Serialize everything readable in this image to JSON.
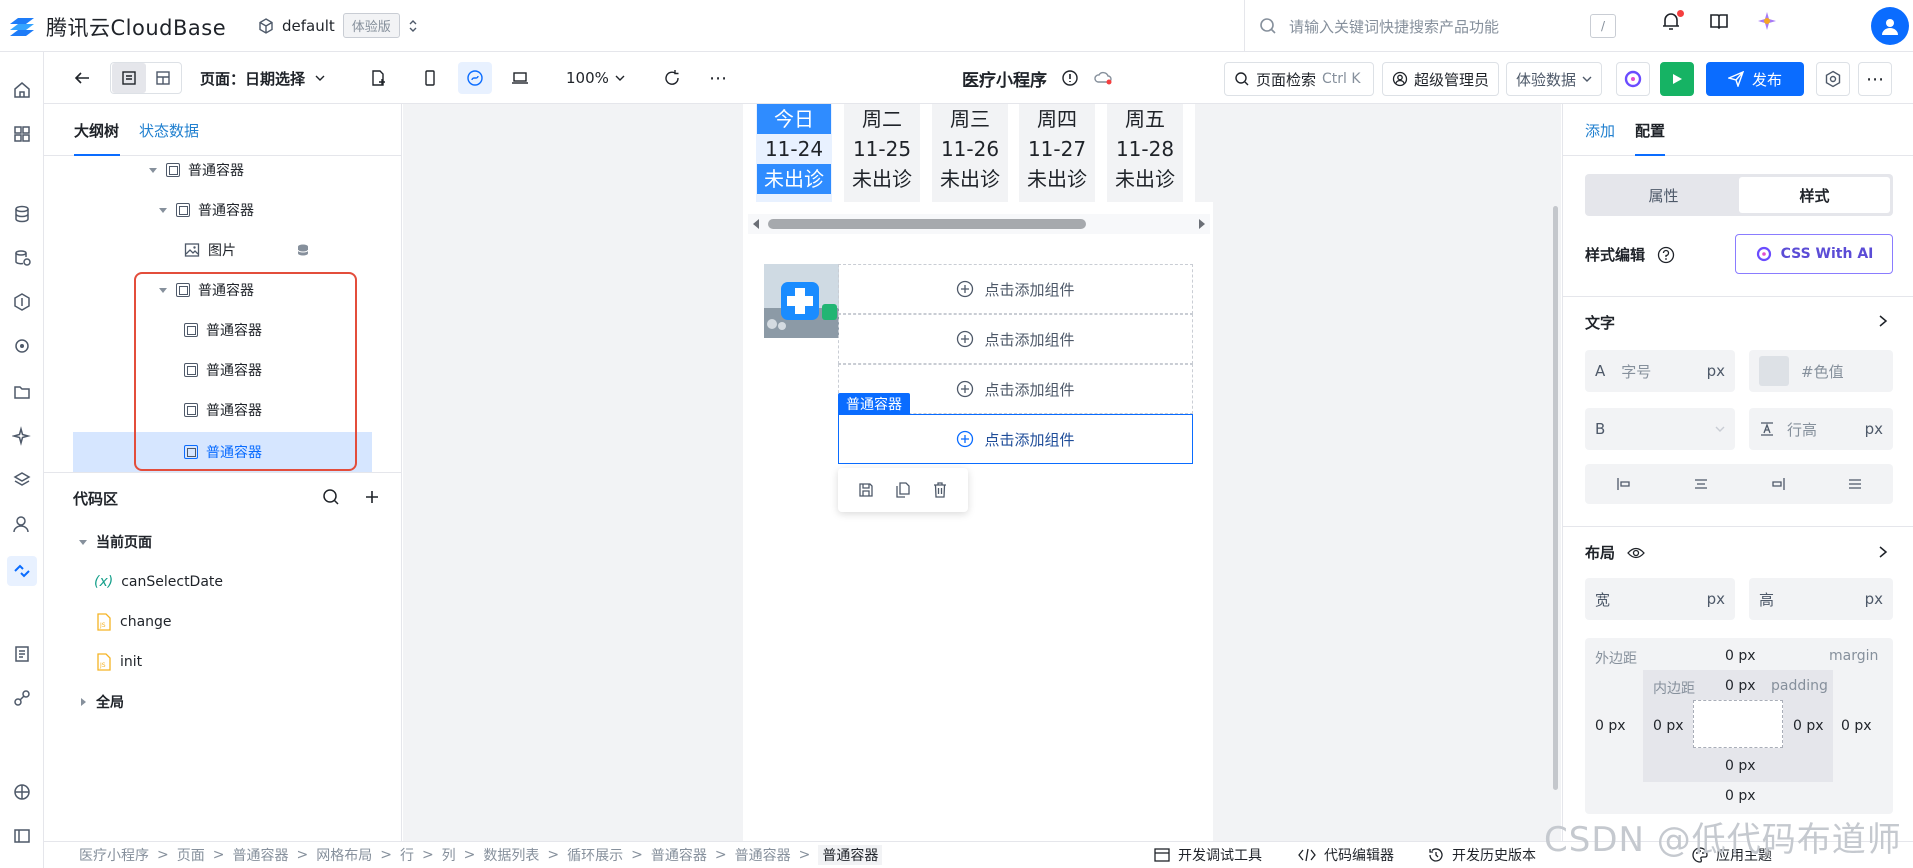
{
  "header": {
    "brand": "腾讯云CloudBase",
    "env_name": "default",
    "env_tag": "体验版",
    "search_placeholder": "请输入关键词快捷搜索产品功能",
    "search_shortcut": "/"
  },
  "toolbar": {
    "page_label": "页面：日期选择",
    "zoom": "100%",
    "app_title": "医疗小程序",
    "page_search": "页面检索",
    "page_search_shortcut": "Ctrl K",
    "role": "超级管理员",
    "data_mode": "体验数据",
    "publish": "发布"
  },
  "outline": {
    "tabs": [
      "大纲树",
      "状态数据"
    ],
    "nodes": [
      {
        "label": "普通容器"
      },
      {
        "label": "普通容器"
      },
      {
        "label": "图片"
      },
      {
        "label": "普通容器"
      },
      {
        "label": "普通容器"
      },
      {
        "label": "普通容器"
      },
      {
        "label": "普通容器"
      },
      {
        "label": "普通容器"
      }
    ]
  },
  "code": {
    "title": "代码区",
    "current_page": "当前页面",
    "items": [
      {
        "label": "canSelectDate",
        "prefix": "(x)"
      },
      {
        "label": "change"
      },
      {
        "label": "init"
      }
    ],
    "global": "全局"
  },
  "canvas": {
    "days": [
      {
        "week": "今日",
        "date": "11-24",
        "status": "未出诊"
      },
      {
        "week": "周二",
        "date": "11-25",
        "status": "未出诊"
      },
      {
        "week": "周三",
        "date": "11-26",
        "status": "未出诊"
      },
      {
        "week": "周四",
        "date": "11-27",
        "status": "未出诊"
      },
      {
        "week": "周五",
        "date": "11-28",
        "status": "未出诊"
      }
    ],
    "add_component": "点击添加组件",
    "selected_tag": "普通容器"
  },
  "rightpanel": {
    "tabs": [
      "添加",
      "配置"
    ],
    "segments": [
      "属性",
      "样式"
    ],
    "style_edit": "样式编辑",
    "css_ai": "CSS With AI",
    "text_section": "文字",
    "font_size_label": "A",
    "font_size_placeholder": "字号",
    "unit": "px",
    "color_placeholder": "#色值",
    "bold_label": "B",
    "line_height_placeholder": "行高",
    "layout_section": "布局",
    "width_label": "宽",
    "height_label": "高",
    "margin_label": "外边距",
    "margin_en": "margin",
    "padding_label": "内边距",
    "padding_en": "padding",
    "zero": "0 px"
  },
  "bottombar": {
    "breadcrumb": [
      "医疗小程序",
      "页面",
      "普通容器",
      "网格布局",
      "行",
      "列",
      "数据列表",
      "循环展示",
      "普通容器",
      "普通容器",
      "普通容器"
    ],
    "devtools": "开发调试工具",
    "code_editor": "代码编辑器",
    "history": "开发历史版本",
    "theme": "应用主题"
  },
  "watermark": "CSDN @低代码布道师",
  "colors": {
    "accent": "#0a6cff",
    "highlight": "#e34d3b",
    "green": "#16b364"
  }
}
